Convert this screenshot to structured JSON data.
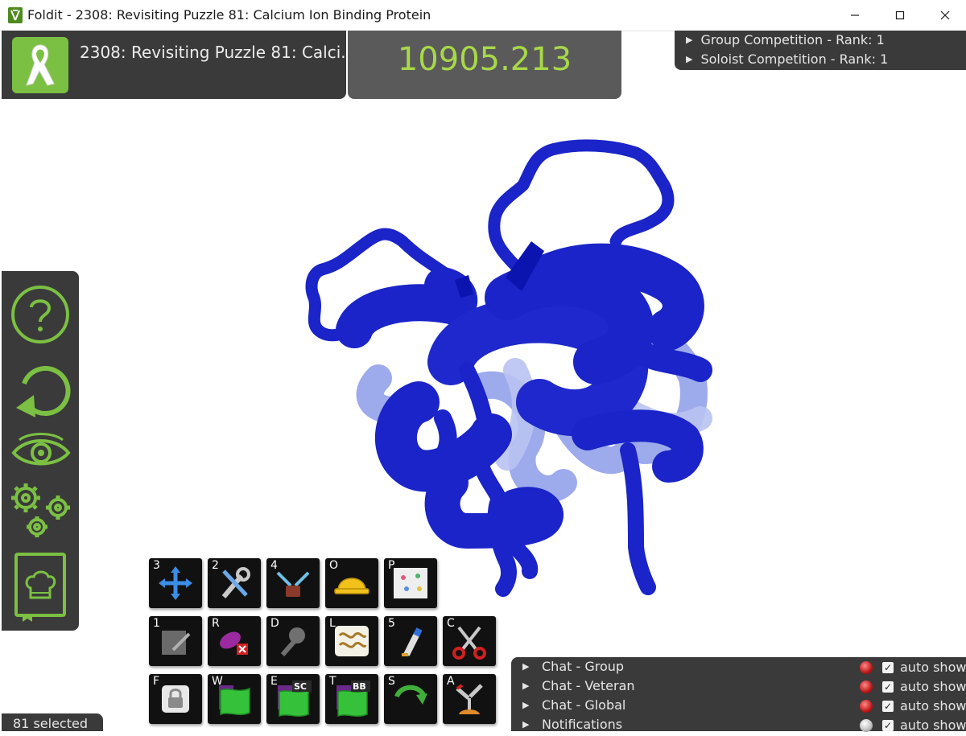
{
  "window": {
    "title": "Foldit - 2308: Revisiting Puzzle 81: Calcium Ion Binding Protein",
    "controls": [
      "minimize-icon",
      "maximize-icon",
      "close-icon"
    ]
  },
  "puzzle": {
    "title": "2308: Revisiting Puzzle 81: Calci...",
    "logo": "ribbon-icon",
    "accent_color": "#7bc043"
  },
  "score": {
    "value": "10905.213",
    "color": "#a8d84a"
  },
  "competitions": [
    {
      "label": "Group Competition  -  Rank: 1"
    },
    {
      "label": "Soloist Competition  -  Rank: 1"
    }
  ],
  "left_toolbar": {
    "icons": [
      "help-icon",
      "undo-icon",
      "view-icon",
      "settings-icon",
      "cookbook-icon"
    ],
    "accent_color": "#7bc043"
  },
  "protein": {
    "color": "#1a24c8",
    "selected_count": 81
  },
  "tools": [
    {
      "key": "3",
      "icon": "move-icon"
    },
    {
      "key": "2",
      "icon": "wrench-icon"
    },
    {
      "key": "4",
      "icon": "rubber-band-icon"
    },
    {
      "key": "O",
      "icon": "hard-hat-icon"
    },
    {
      "key": "P",
      "icon": "notes-icon"
    },
    {
      "key": "1",
      "icon": "note-icon"
    },
    {
      "key": "R",
      "icon": "remove-bands-icon"
    },
    {
      "key": "D",
      "icon": "pull-icon"
    },
    {
      "key": "L",
      "icon": "freeze-icon"
    },
    {
      "key": "5",
      "icon": "paint-icon"
    },
    {
      "key": "C",
      "icon": "scissors-icon"
    },
    {
      "key": "F",
      "icon": "lock-icon"
    },
    {
      "key": "W",
      "icon": "wiggle-icon"
    },
    {
      "key": "E",
      "icon": "wiggle-sidechains-icon",
      "badge": "SC"
    },
    {
      "key": "T",
      "icon": "wiggle-backbone-icon",
      "badge": "BB"
    },
    {
      "key": "S",
      "icon": "shake-icon"
    },
    {
      "key": "A",
      "icon": "mutate-icon"
    }
  ],
  "chat": {
    "rows": [
      {
        "label": "Chat - Group",
        "auto": "auto show"
      },
      {
        "label": "Chat - Veteran",
        "auto": "auto show"
      },
      {
        "label": "Chat - Global",
        "auto": "auto show"
      },
      {
        "label": "Notifications",
        "auto": "auto show"
      }
    ]
  },
  "status": {
    "selection": "81 selected"
  }
}
